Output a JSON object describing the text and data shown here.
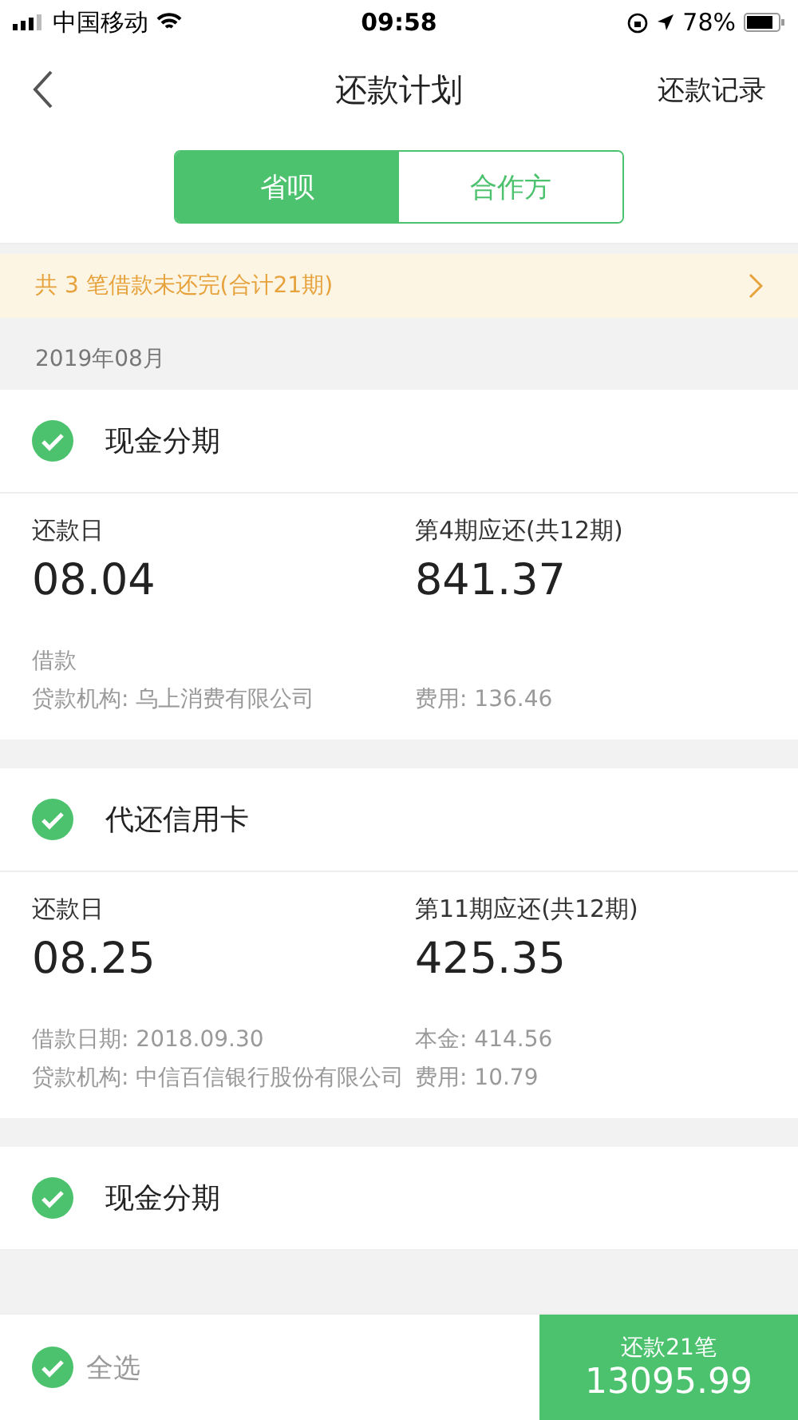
{
  "status_bar": {
    "carrier": "中国移动",
    "time": "09:58",
    "battery": "78%"
  },
  "nav": {
    "title": "还款计划",
    "action": "还款记录"
  },
  "segments": [
    {
      "label": "省呗",
      "selected": true
    },
    {
      "label": "合作方",
      "selected": false
    }
  ],
  "notice": {
    "text": "共 3 笔借款未还完(合计21期)"
  },
  "month": "2019年08月",
  "loans": [
    {
      "name": "现金分期",
      "checked": true,
      "due_label": "还款日",
      "due": "08.04",
      "amount_label": "第4期应还(共12期)",
      "amount": "841.37",
      "details": [
        {
          "left": "借款"
        },
        {
          "left": "贷款机构: 乌上消费有限公司",
          "right": "费用: 136.46"
        }
      ]
    },
    {
      "name": "代还信用卡",
      "checked": true,
      "due_label": "还款日",
      "due": "08.25",
      "amount_label": "第11期应还(共12期)",
      "amount": "425.35",
      "details": [
        {
          "left": "借款日期: 2018.09.30",
          "right": "本金: 414.56"
        },
        {
          "left": "贷款机构: 中信百信银行股份有限公司",
          "right": "费用: 10.79"
        }
      ]
    },
    {
      "name": "现金分期",
      "checked": true
    }
  ],
  "footer": {
    "select_all": "全选",
    "select_all_checked": true,
    "pay_label": "还款21笔",
    "pay_amount": "13095.99"
  }
}
